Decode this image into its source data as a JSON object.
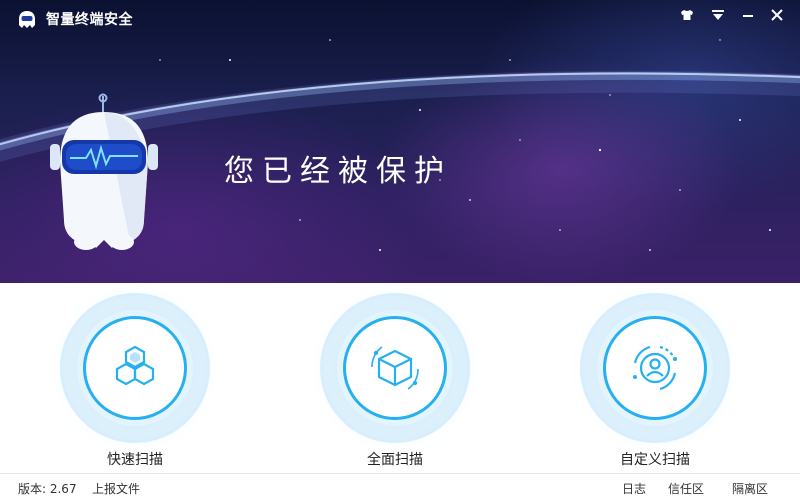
{
  "app": {
    "title": "智量终端安全",
    "status_text": "您已经被保护"
  },
  "window_controls": [
    {
      "name": "skin-button",
      "icon": "shirt-icon"
    },
    {
      "name": "menu-button",
      "icon": "menu-dropdown-icon"
    },
    {
      "name": "minimize-button",
      "icon": "minimize-icon"
    },
    {
      "name": "close-button",
      "icon": "close-icon"
    }
  ],
  "scans": [
    {
      "label": "快速扫描",
      "icon": "hexagon-cluster-icon"
    },
    {
      "label": "全面扫描",
      "icon": "cube-icon"
    },
    {
      "label": "自定义扫描",
      "icon": "user-circle-icon"
    }
  ],
  "statusbar": {
    "version": "版本: 2.67",
    "upload": "上报文件",
    "log": "日志",
    "trust": "信任区",
    "quarantine": "隔离区"
  },
  "colors": {
    "accent": "#27b0ef",
    "hero_top": "#0b1130",
    "hero_bottom": "#3b2168"
  }
}
